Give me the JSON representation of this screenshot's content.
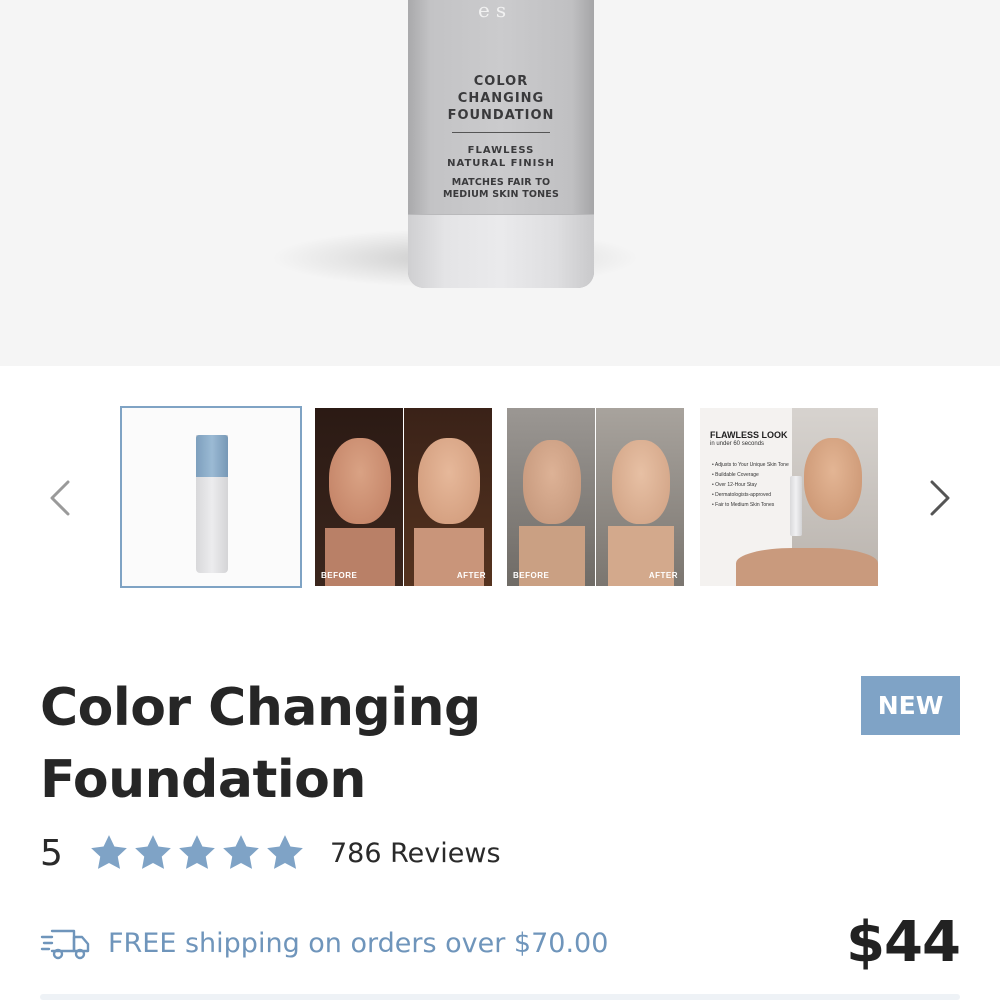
{
  "hero": {
    "bottle_label": {
      "brand": "es",
      "line1": "COLOR",
      "line2": "CHANGING",
      "line3": "FOUNDATION",
      "line4": "FLAWLESS",
      "line5": "NATURAL FINISH",
      "line6": "MATCHES FAIR TO",
      "line7": "MEDIUM SKIN TONES"
    }
  },
  "carousel": {
    "prev_icon": "chevron-left-icon",
    "next_icon": "chevron-right-icon",
    "selected_index": 0,
    "thumbs": [
      {
        "kind": "product-bottle"
      },
      {
        "kind": "before-after",
        "before_label": "BEFORE",
        "after_label": "AFTER"
      },
      {
        "kind": "before-after",
        "before_label": "BEFORE",
        "after_label": "AFTER"
      },
      {
        "kind": "promo",
        "title": "FLAWLESS LOOK",
        "subtitle": "in under 60 seconds",
        "bullets": [
          "Adjusts to Your Unique Skin Tone",
          "Buildable Coverage",
          "Over 12-Hour Stay",
          "Dermatologists-approved",
          "Fair to Medium Skin Tones"
        ]
      }
    ]
  },
  "product": {
    "title_line1": "Color Changing",
    "title_line2": "Foundation",
    "badge": "NEW",
    "rating": "5",
    "rating_value": 5,
    "rating_max": 5,
    "reviews": "786 Reviews",
    "shipping": "FREE shipping on orders over $70.00",
    "shipping_icon": "delivery-truck-icon",
    "price": "$44"
  },
  "colors": {
    "accent_blue": "#7fa3c6",
    "text_dark": "#262626",
    "shipping_blue": "#6f95bb"
  }
}
